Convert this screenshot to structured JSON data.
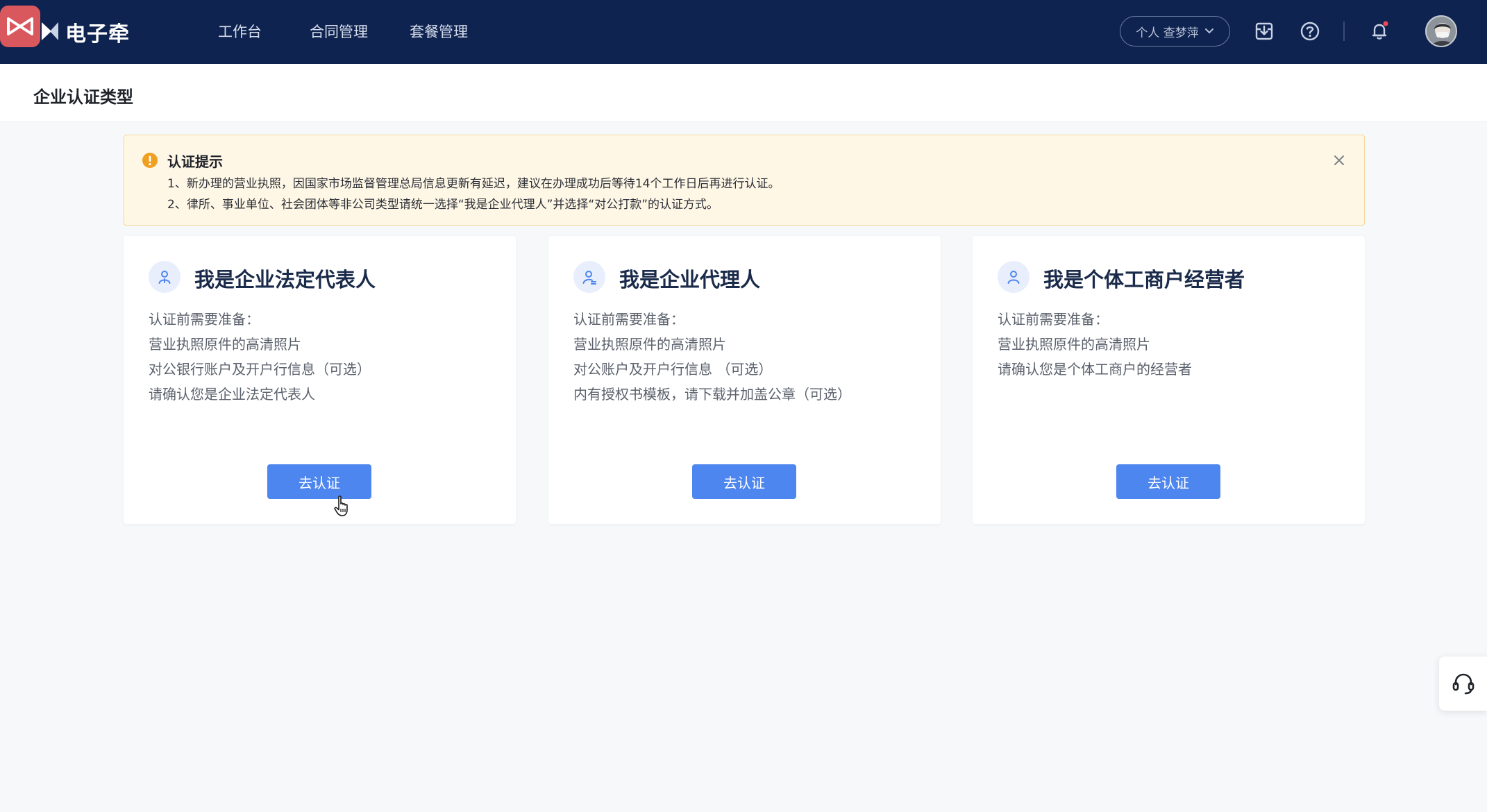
{
  "app": {
    "logo_text": "电子牵"
  },
  "nav": {
    "items": [
      {
        "label": "工作台"
      },
      {
        "label": "合同管理"
      },
      {
        "label": "套餐管理"
      }
    ],
    "account_switch": "个人 查梦萍"
  },
  "page": {
    "title": "企业认证类型"
  },
  "alert": {
    "title": "认证提示",
    "lines": [
      "1、新办理的营业执照，因国家市场监督管理总局信息更新有延迟，建议在办理成功后等待14个工作日后再进行认证。",
      "2、律所、事业单位、社会团体等非公司类型请统一选择“我是企业代理人”并选择“对公打款”的认证方式。"
    ]
  },
  "cards": [
    {
      "title": "我是企业法定代表人",
      "lines": [
        "认证前需要准备：",
        "营业执照原件的高清照片",
        "对公银行账户及开户行信息（可选）",
        "请确认您是企业法定代表人"
      ],
      "button": "去认证"
    },
    {
      "title": "我是企业代理人",
      "lines": [
        "认证前需要准备：",
        "营业执照原件的高清照片",
        "对公账户及开户行信息 （可选）",
        "内有授权书模板，请下载并加盖公章（可选）"
      ],
      "button": "去认证"
    },
    {
      "title": "我是个体工商户经营者",
      "lines": [
        "认证前需要准备：",
        "营业执照原件的高清照片",
        "请确认您是个体工商户的经营者"
      ],
      "button": "去认证"
    }
  ],
  "icons": {
    "logo": "logo-icon",
    "download": "download-icon",
    "help": "help-icon",
    "bell": "bell-icon",
    "alert": "warning-icon",
    "close": "close-icon",
    "service": "headset-icon"
  },
  "colors": {
    "nav_bg": "#0f2350",
    "primary": "#4e86f0",
    "alert_bg": "#fff7e6",
    "alert_icon": "#f0a020",
    "notification_dot": "#f5455c"
  }
}
